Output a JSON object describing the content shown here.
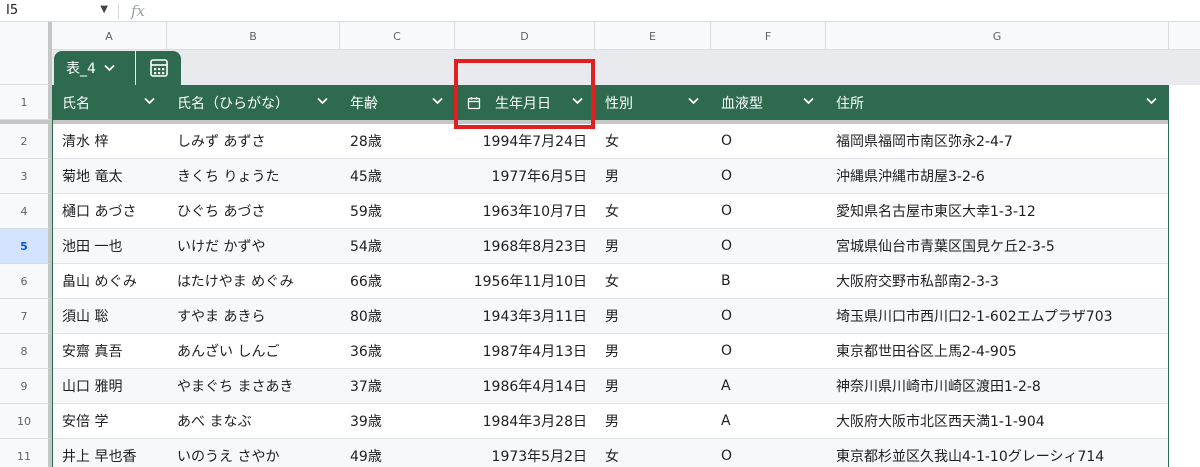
{
  "formula_bar": {
    "cell_ref": "I5",
    "fx_label": "fx"
  },
  "columns": [
    "A",
    "B",
    "C",
    "D",
    "E",
    "F",
    "G"
  ],
  "table": {
    "name": "表_4",
    "headers": [
      "氏名",
      "氏名（ひらがな）",
      "年齢",
      "生年月日",
      "性別",
      "血液型",
      "住所"
    ],
    "rows": [
      {
        "num": "2",
        "cells": [
          "清水 梓",
          "しみず あずさ",
          "28歳",
          "1994年7月24日",
          "女",
          "O",
          "福岡県福岡市南区弥永2-4-7"
        ]
      },
      {
        "num": "3",
        "cells": [
          "菊地 竜太",
          "きくち りょうた",
          "45歳",
          "1977年6月5日",
          "男",
          "O",
          "沖縄県沖縄市胡屋3-2-6"
        ]
      },
      {
        "num": "4",
        "cells": [
          "樋口 あづさ",
          "ひぐち あづさ",
          "59歳",
          "1963年10月7日",
          "女",
          "O",
          "愛知県名古屋市東区大幸1-3-12"
        ]
      },
      {
        "num": "5",
        "cells": [
          "池田 一也",
          "いけだ かずや",
          "54歳",
          "1968年8月23日",
          "男",
          "O",
          "宮城県仙台市青葉区国見ケ丘2-3-5"
        ]
      },
      {
        "num": "6",
        "cells": [
          "畠山 めぐみ",
          "はたけやま めぐみ",
          "66歳",
          "1956年11月10日",
          "女",
          "B",
          "大阪府交野市私部南2-3-3"
        ]
      },
      {
        "num": "7",
        "cells": [
          "須山 聡",
          "すやま あきら",
          "80歳",
          "1943年3月11日",
          "男",
          "O",
          "埼玉県川口市西川口2-1-602エムプラザ703"
        ]
      },
      {
        "num": "8",
        "cells": [
          "安齋 真吾",
          "あんざい しんご",
          "36歳",
          "1987年4月13日",
          "男",
          "O",
          "東京都世田谷区上馬2-4-905"
        ]
      },
      {
        "num": "9",
        "cells": [
          "山口 雅明",
          "やまぐち まさあき",
          "37歳",
          "1986年4月14日",
          "男",
          "A",
          "神奈川県川崎市川崎区渡田1-2-8"
        ]
      },
      {
        "num": "10",
        "cells": [
          "安倍 学",
          "あべ まなぶ",
          "39歳",
          "1984年3月28日",
          "男",
          "A",
          "大阪府大阪市北区西天満1-1-904"
        ]
      },
      {
        "num": "11",
        "cells": [
          "井上 早也香",
          "いのうえ さやか",
          "49歳",
          "1973年5月2日",
          "女",
          "O",
          "東京都杉並区久我山4-1-10グレーシィ714"
        ]
      }
    ]
  },
  "header_row_num": "1",
  "selected_row": "5",
  "colors": {
    "table_green": "#2d6a4f",
    "highlight_red": "#e02020"
  }
}
